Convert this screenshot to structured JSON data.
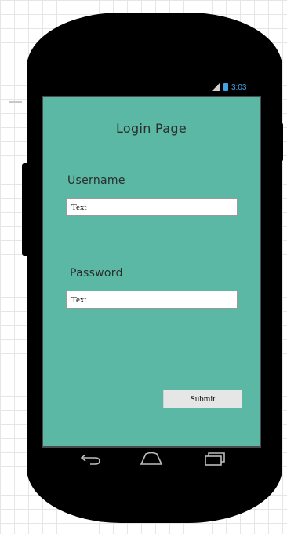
{
  "status_bar": {
    "time": "3:03",
    "signal_icon": "signal-icon",
    "battery_icon": "battery-icon"
  },
  "login": {
    "title": "Login Page",
    "username_label": "Username",
    "username_value": "Text",
    "password_label": "Password",
    "password_value": "Text",
    "submit_label": "Submit"
  },
  "nav_bar": {
    "icons": [
      "back-icon",
      "home-icon",
      "recent-apps-icon"
    ]
  },
  "colors": {
    "screen_background": "#5ab8a4",
    "device_body": "#000000",
    "status_accent": "#3ea6e6",
    "button_background": "#e6e6e6"
  }
}
